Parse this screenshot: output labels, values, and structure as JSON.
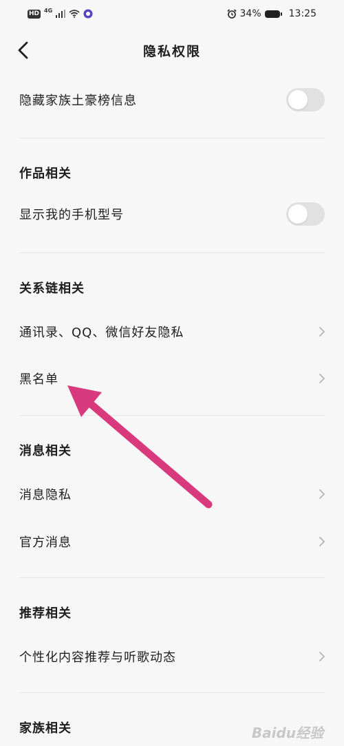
{
  "status_bar": {
    "hd": "HD",
    "network": "4G",
    "battery_pct": "34%",
    "time": "13:25",
    "icons": [
      "hd-icon",
      "signal-icon",
      "wifi-icon",
      "app-icon",
      "alarm-icon",
      "battery-icon"
    ]
  },
  "nav": {
    "title": "隐私权限",
    "back_icon": "chevron-left-icon"
  },
  "rows": {
    "hide_family": {
      "label": "隐藏家族土豪榜信息",
      "toggle_on": false
    },
    "show_phone": {
      "label": "显示我的手机型号",
      "toggle_on": false
    },
    "contacts_privacy": {
      "label": "通讯录、QQ、微信好友隐私"
    },
    "blacklist": {
      "label": "黑名单"
    },
    "message_privacy": {
      "label": "消息隐私"
    },
    "official_msg": {
      "label": "官方消息"
    },
    "personalized": {
      "label": "个性化内容推荐与听歌动态"
    }
  },
  "sections": {
    "works": "作品相关",
    "relations": "关系链相关",
    "messages": "消息相关",
    "recommend": "推荐相关",
    "family": "家族相关"
  },
  "annotation": {
    "arrow_color": "#d93a7e"
  },
  "watermark": "Baidu经验"
}
